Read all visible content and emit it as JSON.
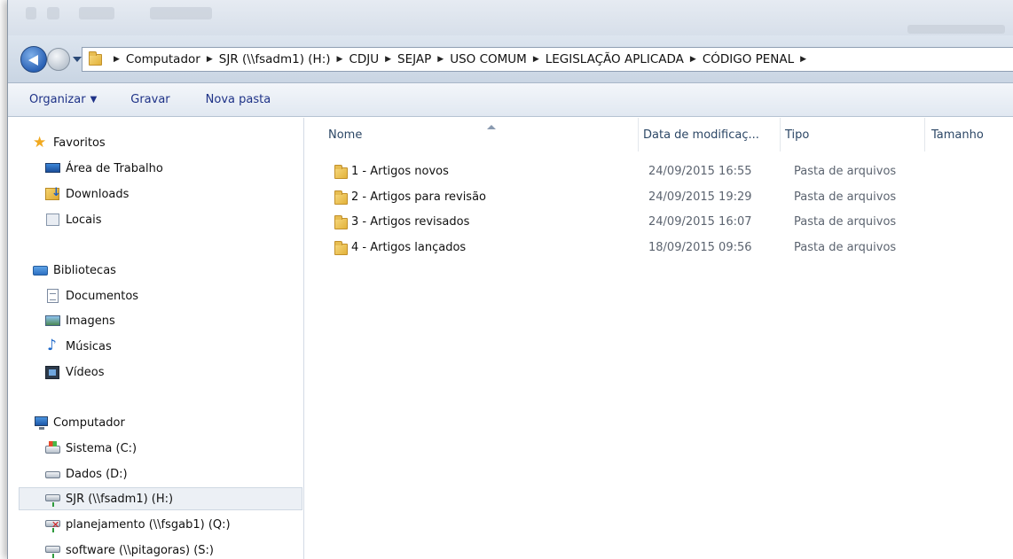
{
  "address_bar": {
    "breadcrumbs": [
      "Computador",
      "SJR (\\\\fsadm1) (H:)",
      "CDJU",
      "SEJAP",
      "USO COMUM",
      "LEGISLAÇÃO APLICADA",
      "CÓDIGO PENAL"
    ],
    "trailing_separator": "▸"
  },
  "toolbar": {
    "organize_label": "Organizar",
    "burn_label": "Gravar",
    "new_folder_label": "Nova pasta"
  },
  "nav_pane": {
    "favorites_label": "Favoritos",
    "favorites": [
      "Área de Trabalho",
      "Downloads",
      "Locais"
    ],
    "libraries_label": "Bibliotecas",
    "libraries": [
      "Documentos",
      "Imagens",
      "Músicas",
      "Vídeos"
    ],
    "computer_label": "Computador",
    "drives": [
      "Sistema (C:)",
      "Dados (D:)",
      "SJR (\\\\fsadm1) (H:)",
      "planejamento (\\\\fsgab1) (Q:)",
      "software (\\\\pitagoras) (S:)"
    ],
    "selected_drive": "SJR (\\\\fsadm1) (H:)"
  },
  "columns": {
    "name": "Nome",
    "date": "Data de modificaç...",
    "type": "Tipo",
    "size": "Tamanho"
  },
  "files": [
    {
      "name": "1 - Artigos novos",
      "date": "24/09/2015 16:55",
      "type": "Pasta de arquivos"
    },
    {
      "name": "2 - Artigos para revisão",
      "date": "24/09/2015 19:29",
      "type": "Pasta de arquivos"
    },
    {
      "name": "3 - Artigos revisados",
      "date": "24/09/2015 16:07",
      "type": "Pasta de arquivos"
    },
    {
      "name": "4 - Artigos lançados",
      "date": "18/09/2015 09:56",
      "type": "Pasta de arquivos"
    }
  ],
  "icons": {
    "back": "back-arrow-icon",
    "forward": "forward-arrow-icon",
    "folder": "folder-icon",
    "star": "star-icon"
  }
}
